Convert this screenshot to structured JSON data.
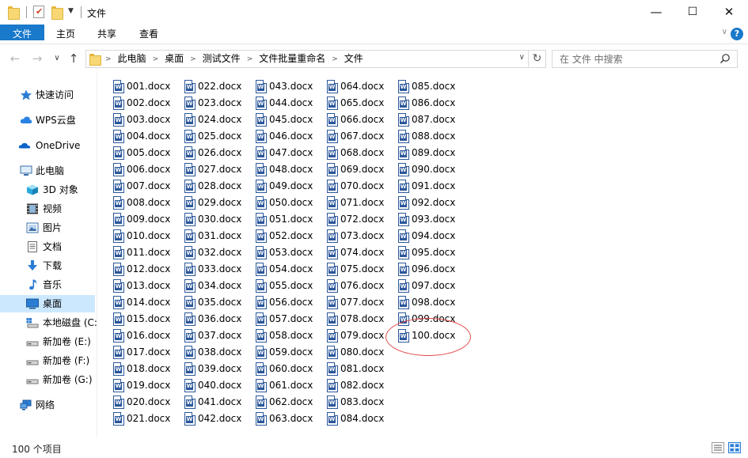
{
  "window": {
    "title": "文件",
    "controls": {
      "minimize": "—",
      "maximize": "☐",
      "close": "✕"
    }
  },
  "ribbon": {
    "tabs": [
      "文件",
      "主页",
      "共享",
      "查看"
    ]
  },
  "navigation": {
    "breadcrumbs": [
      "此电脑",
      "桌面",
      "测试文件",
      "文件批量重命名",
      "文件"
    ],
    "search_placeholder": "在 文件 中搜索"
  },
  "sidebar": {
    "items": [
      {
        "label": "快速访问",
        "icon": "star-icon"
      },
      {
        "label": "WPS云盘",
        "icon": "cloud-icon"
      },
      {
        "label": "OneDrive",
        "icon": "onedrive-icon"
      },
      {
        "label": "此电脑",
        "icon": "computer-icon"
      },
      {
        "label": "3D 对象",
        "icon": "cube-3d-icon"
      },
      {
        "label": "视频",
        "icon": "film-icon"
      },
      {
        "label": "图片",
        "icon": "picture-icon"
      },
      {
        "label": "文档",
        "icon": "document-icon"
      },
      {
        "label": "下载",
        "icon": "download-arrow-icon"
      },
      {
        "label": "音乐",
        "icon": "music-note-icon"
      },
      {
        "label": "桌面",
        "icon": "desktop-icon",
        "selected": true
      },
      {
        "label": "本地磁盘 (C:",
        "icon": "system-drive-icon"
      },
      {
        "label": "新加卷 (E:)",
        "icon": "drive-icon"
      },
      {
        "label": "新加卷 (F:)",
        "icon": "drive-icon"
      },
      {
        "label": "新加卷 (G:)",
        "icon": "drive-icon"
      },
      {
        "label": "网络",
        "icon": "network-icon"
      }
    ]
  },
  "files": [
    "001.docx",
    "002.docx",
    "003.docx",
    "004.docx",
    "005.docx",
    "006.docx",
    "007.docx",
    "008.docx",
    "009.docx",
    "010.docx",
    "011.docx",
    "012.docx",
    "013.docx",
    "014.docx",
    "015.docx",
    "016.docx",
    "017.docx",
    "018.docx",
    "019.docx",
    "020.docx",
    "021.docx",
    "022.docx",
    "023.docx",
    "024.docx",
    "025.docx",
    "026.docx",
    "027.docx",
    "028.docx",
    "029.docx",
    "030.docx",
    "031.docx",
    "032.docx",
    "033.docx",
    "034.docx",
    "035.docx",
    "036.docx",
    "037.docx",
    "038.docx",
    "039.docx",
    "040.docx",
    "041.docx",
    "042.docx",
    "043.docx",
    "044.docx",
    "045.docx",
    "046.docx",
    "047.docx",
    "048.docx",
    "049.docx",
    "050.docx",
    "051.docx",
    "052.docx",
    "053.docx",
    "054.docx",
    "055.docx",
    "056.docx",
    "057.docx",
    "058.docx",
    "059.docx",
    "060.docx",
    "061.docx",
    "062.docx",
    "063.docx",
    "064.docx",
    "065.docx",
    "066.docx",
    "067.docx",
    "068.docx",
    "069.docx",
    "070.docx",
    "071.docx",
    "072.docx",
    "073.docx",
    "074.docx",
    "075.docx",
    "076.docx",
    "077.docx",
    "078.docx",
    "079.docx",
    "080.docx",
    "081.docx",
    "082.docx",
    "083.docx",
    "084.docx",
    "085.docx",
    "086.docx",
    "087.docx",
    "088.docx",
    "089.docx",
    "090.docx",
    "091.docx",
    "092.docx",
    "093.docx",
    "094.docx",
    "095.docx",
    "096.docx",
    "097.docx",
    "098.docx",
    "099.docx",
    "100.docx"
  ],
  "status": {
    "item_count": "100 个项目"
  },
  "colors": {
    "accent": "#1979ca",
    "selection": "#cce8ff",
    "word_blue": "#2b579a",
    "annotation": "#e24a4a"
  }
}
